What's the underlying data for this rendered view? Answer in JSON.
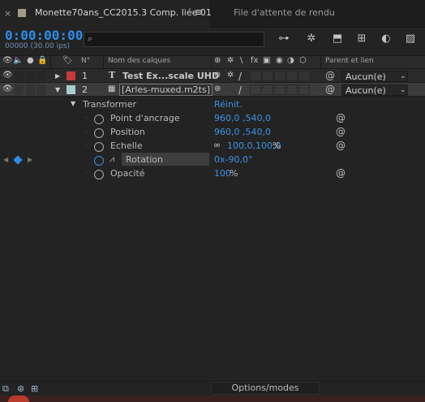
{
  "tabs": {
    "active": {
      "close": "×",
      "title": "Monette70ans_CC2015.3 Comp. liée 01",
      "menu": "≡"
    },
    "second": {
      "title": "File d'attente de rendu"
    }
  },
  "time": {
    "timecode": "0:00:00:00",
    "frames": "00000 (30.00 ips)"
  },
  "search": {
    "icon": "⌕"
  },
  "toolbar": [
    "⊶",
    "✲",
    "⬒",
    "⊞",
    "◐",
    "▨"
  ],
  "columns": {
    "num": "N°",
    "name": "Nom des calques",
    "parent": "Parent et lien",
    "switch_icons": [
      "⊕",
      "✲",
      "\\",
      "fx",
      "▣",
      "◉",
      "◑",
      "⬡"
    ],
    "av_icons": [
      "👁",
      "🔈",
      "●",
      "🔒"
    ],
    "label_icon": "🏷"
  },
  "layers": [
    {
      "num": "1",
      "type_icon": "T",
      "name": "Test Ex...scale UHD",
      "color": "#c43b3b",
      "parent": "Aucun(e)",
      "eye": "👁",
      "twirl": "▶"
    },
    {
      "num": "2",
      "type_icon": "▦",
      "name": "[Arles-muxed.m2ts]",
      "color": "#a7cfcf",
      "parent": "Aucun(e)",
      "eye": "👁",
      "twirl": "▼"
    }
  ],
  "transform": {
    "label": "Transformer",
    "reset": "Réinit.",
    "twirl": "▼",
    "props": [
      {
        "name": "Point d'ancrage",
        "value": "960,0 ,540,0",
        "unit": ""
      },
      {
        "name": "Position",
        "value": "960,0 ,540,0",
        "unit": ""
      },
      {
        "name": "Echelle",
        "value": "100,0,100,0",
        "unit": "%"
      },
      {
        "name": "Rotation",
        "value": "0x-90,0°",
        "unit": ""
      },
      {
        "name": "Opacité",
        "value": "100",
        "unit": "%"
      }
    ]
  },
  "bottom": {
    "options_label": "Options/modes"
  }
}
